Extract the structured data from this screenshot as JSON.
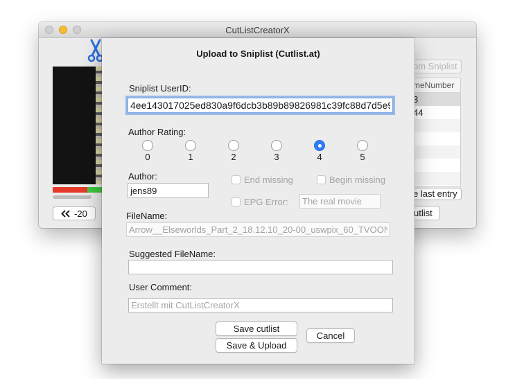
{
  "main_window": {
    "title": "CutListCreatorX",
    "skip_back_label": "-20",
    "from_sniplist_label": "om Sniplist",
    "list_header": "meNumber",
    "list_rows": [
      "3",
      "44",
      "",
      "",
      "",
      "",
      ""
    ],
    "last_entry_label": "e last entry",
    "cutlist_label": "utlist"
  },
  "dialog": {
    "title": "Upload to Sniplist (Cutlist.at)",
    "userid_label": "Sniplist UserID:",
    "userid_value": "4ee143017025ed830a9f6dcb3b89b89826981c39fc88d7d5e9",
    "rating_label": "Author Rating:",
    "ratings": [
      "0",
      "1",
      "2",
      "3",
      "4",
      "5"
    ],
    "selected_rating": "4",
    "author_label": "Author:",
    "author_value": "jens89",
    "end_missing_label": "End missing",
    "begin_missing_label": "Begin missing",
    "epg_error_label": "EPG Error:",
    "epg_placeholder": "The real movie",
    "filename_label": "FileName:",
    "filename_value": "Arrow__Elseworlds_Part_2_18.12.10_20-00_uswpix_60_TVOON_",
    "suggested_label": "Suggested FileName:",
    "suggested_value": "",
    "comment_label": "User Comment:",
    "comment_placeholder": "Erstellt mit CutListCreatorX",
    "save_cutlist_label": "Save cutlist",
    "save_upload_label": "Save & Upload",
    "cancel_label": "Cancel"
  },
  "colors": {
    "accent": "#2e7cf6",
    "focus_ring": "#5091e6",
    "timeline_red": "#e53a2a",
    "timeline_green": "#3fc93f",
    "minimize_yellow": "#f5bd2f"
  },
  "icons": {
    "app_logo": "scissors-icon",
    "skip_back": "double-chevron-left-icon"
  }
}
